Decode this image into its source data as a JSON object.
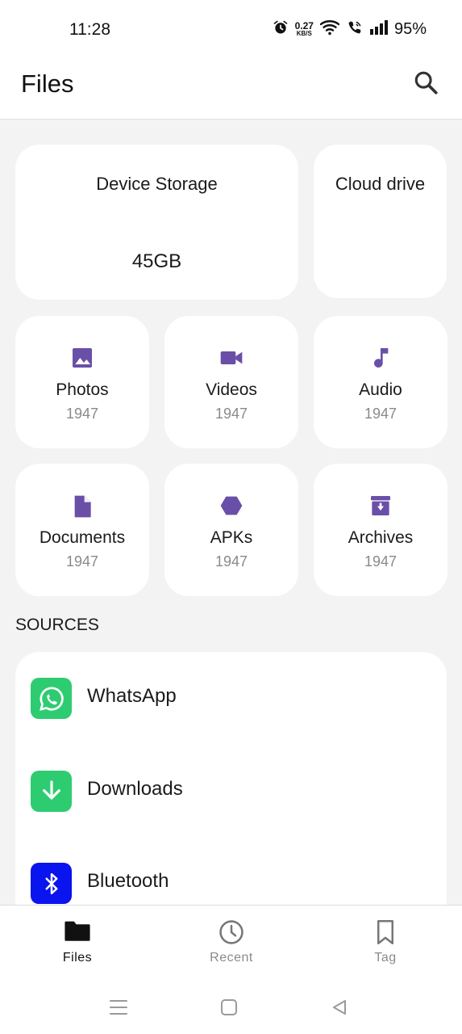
{
  "status": {
    "time": "11:28",
    "net_speed_value": "0.27",
    "net_speed_unit": "KB/S",
    "battery": "95%"
  },
  "header": {
    "title": "Files",
    "search_icon": "search-icon"
  },
  "storage": {
    "device_title": "Device Storage",
    "device_size": "45GB",
    "cloud_title": "Cloud drive"
  },
  "categories": [
    {
      "label": "Photos",
      "count": "1947",
      "icon": "image-icon"
    },
    {
      "label": "Videos",
      "count": "1947",
      "icon": "videocam-icon"
    },
    {
      "label": "Audio",
      "count": "1947",
      "icon": "music-note-icon"
    },
    {
      "label": "Documents",
      "count": "1947",
      "icon": "document-icon"
    },
    {
      "label": "APKs",
      "count": "1947",
      "icon": "hexagon-icon"
    },
    {
      "label": "Archives",
      "count": "1947",
      "icon": "archive-icon"
    }
  ],
  "sources": {
    "heading": "SOURCES",
    "items": [
      {
        "label": "WhatsApp",
        "icon": "whatsapp-icon",
        "color": "#2ecc71"
      },
      {
        "label": "Downloads",
        "icon": "download-icon",
        "color": "#2ecc71"
      },
      {
        "label": "Bluetooth",
        "icon": "bluetooth-icon",
        "color": "#0a14ee"
      }
    ]
  },
  "bottom_nav": {
    "items": [
      {
        "label": "Files",
        "icon": "folder-icon",
        "active": true
      },
      {
        "label": "Recent",
        "icon": "clock-icon",
        "active": false
      },
      {
        "label": "Tag",
        "icon": "bookmark-icon",
        "active": false
      }
    ]
  },
  "colors": {
    "accent": "#6a4fa8",
    "background": "#f3f3f3",
    "card": "#ffffff",
    "source_green": "#2ecc71",
    "source_blue": "#0a14ee"
  }
}
